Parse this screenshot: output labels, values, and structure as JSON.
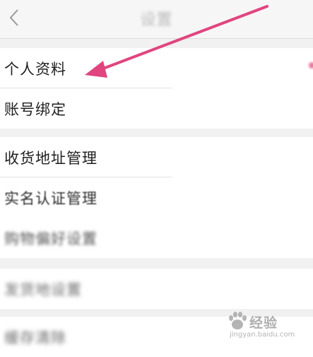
{
  "header": {
    "title": "设置",
    "back_icon": "chevron-left-icon"
  },
  "sections": [
    {
      "items": [
        {
          "label": "个人资料"
        },
        {
          "label": "账号绑定"
        }
      ]
    },
    {
      "items": [
        {
          "label": "收货地址管理"
        },
        {
          "label": "实名认证管理"
        },
        {
          "label": "购物偏好设置"
        }
      ]
    },
    {
      "items": [
        {
          "label": "发货地设置"
        }
      ]
    },
    {
      "items": [
        {
          "label": "缓存清除"
        }
      ]
    }
  ],
  "annotation": {
    "arrow_color": "#e0457f",
    "points_to": "个人资料"
  },
  "watermark": {
    "text": "经验",
    "url": "jingyan.baidu.com"
  },
  "colors": {
    "background": "#f1f1f1",
    "row_background": "#ffffff",
    "notification_dot": "#f0739e"
  }
}
